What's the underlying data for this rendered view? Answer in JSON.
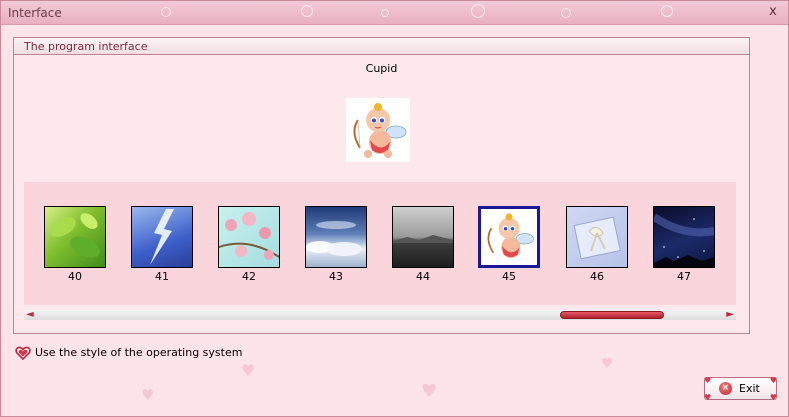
{
  "window": {
    "title": "Interface",
    "close_glyph": "x"
  },
  "group": {
    "title": "The program interface"
  },
  "selected": {
    "name": "Cupid"
  },
  "thumbnails": [
    {
      "number": "40",
      "icon": "green-leaves-image",
      "selected": false
    },
    {
      "number": "41",
      "icon": "lightning-image",
      "selected": false
    },
    {
      "number": "42",
      "icon": "cherry-blossom-image",
      "selected": false
    },
    {
      "number": "43",
      "icon": "clouds-sky-image",
      "selected": false
    },
    {
      "number": "44",
      "icon": "grey-sea-image",
      "selected": false
    },
    {
      "number": "45",
      "icon": "cupid-image",
      "selected": true
    },
    {
      "number": "46",
      "icon": "gift-box-image",
      "selected": false
    },
    {
      "number": "47",
      "icon": "night-sky-image",
      "selected": false
    }
  ],
  "scrollbar": {
    "left_arrow": "◄",
    "right_arrow": "►"
  },
  "options": {
    "use_os_style_label": "Use the style of the operating system",
    "use_os_style_checked": true
  },
  "buttons": {
    "exit_label": "Exit",
    "exit_icon_glyph": "×"
  },
  "colors": {
    "accent": "#c0273c",
    "selection_border": "#1a1a99",
    "background": "#fde4e8"
  }
}
